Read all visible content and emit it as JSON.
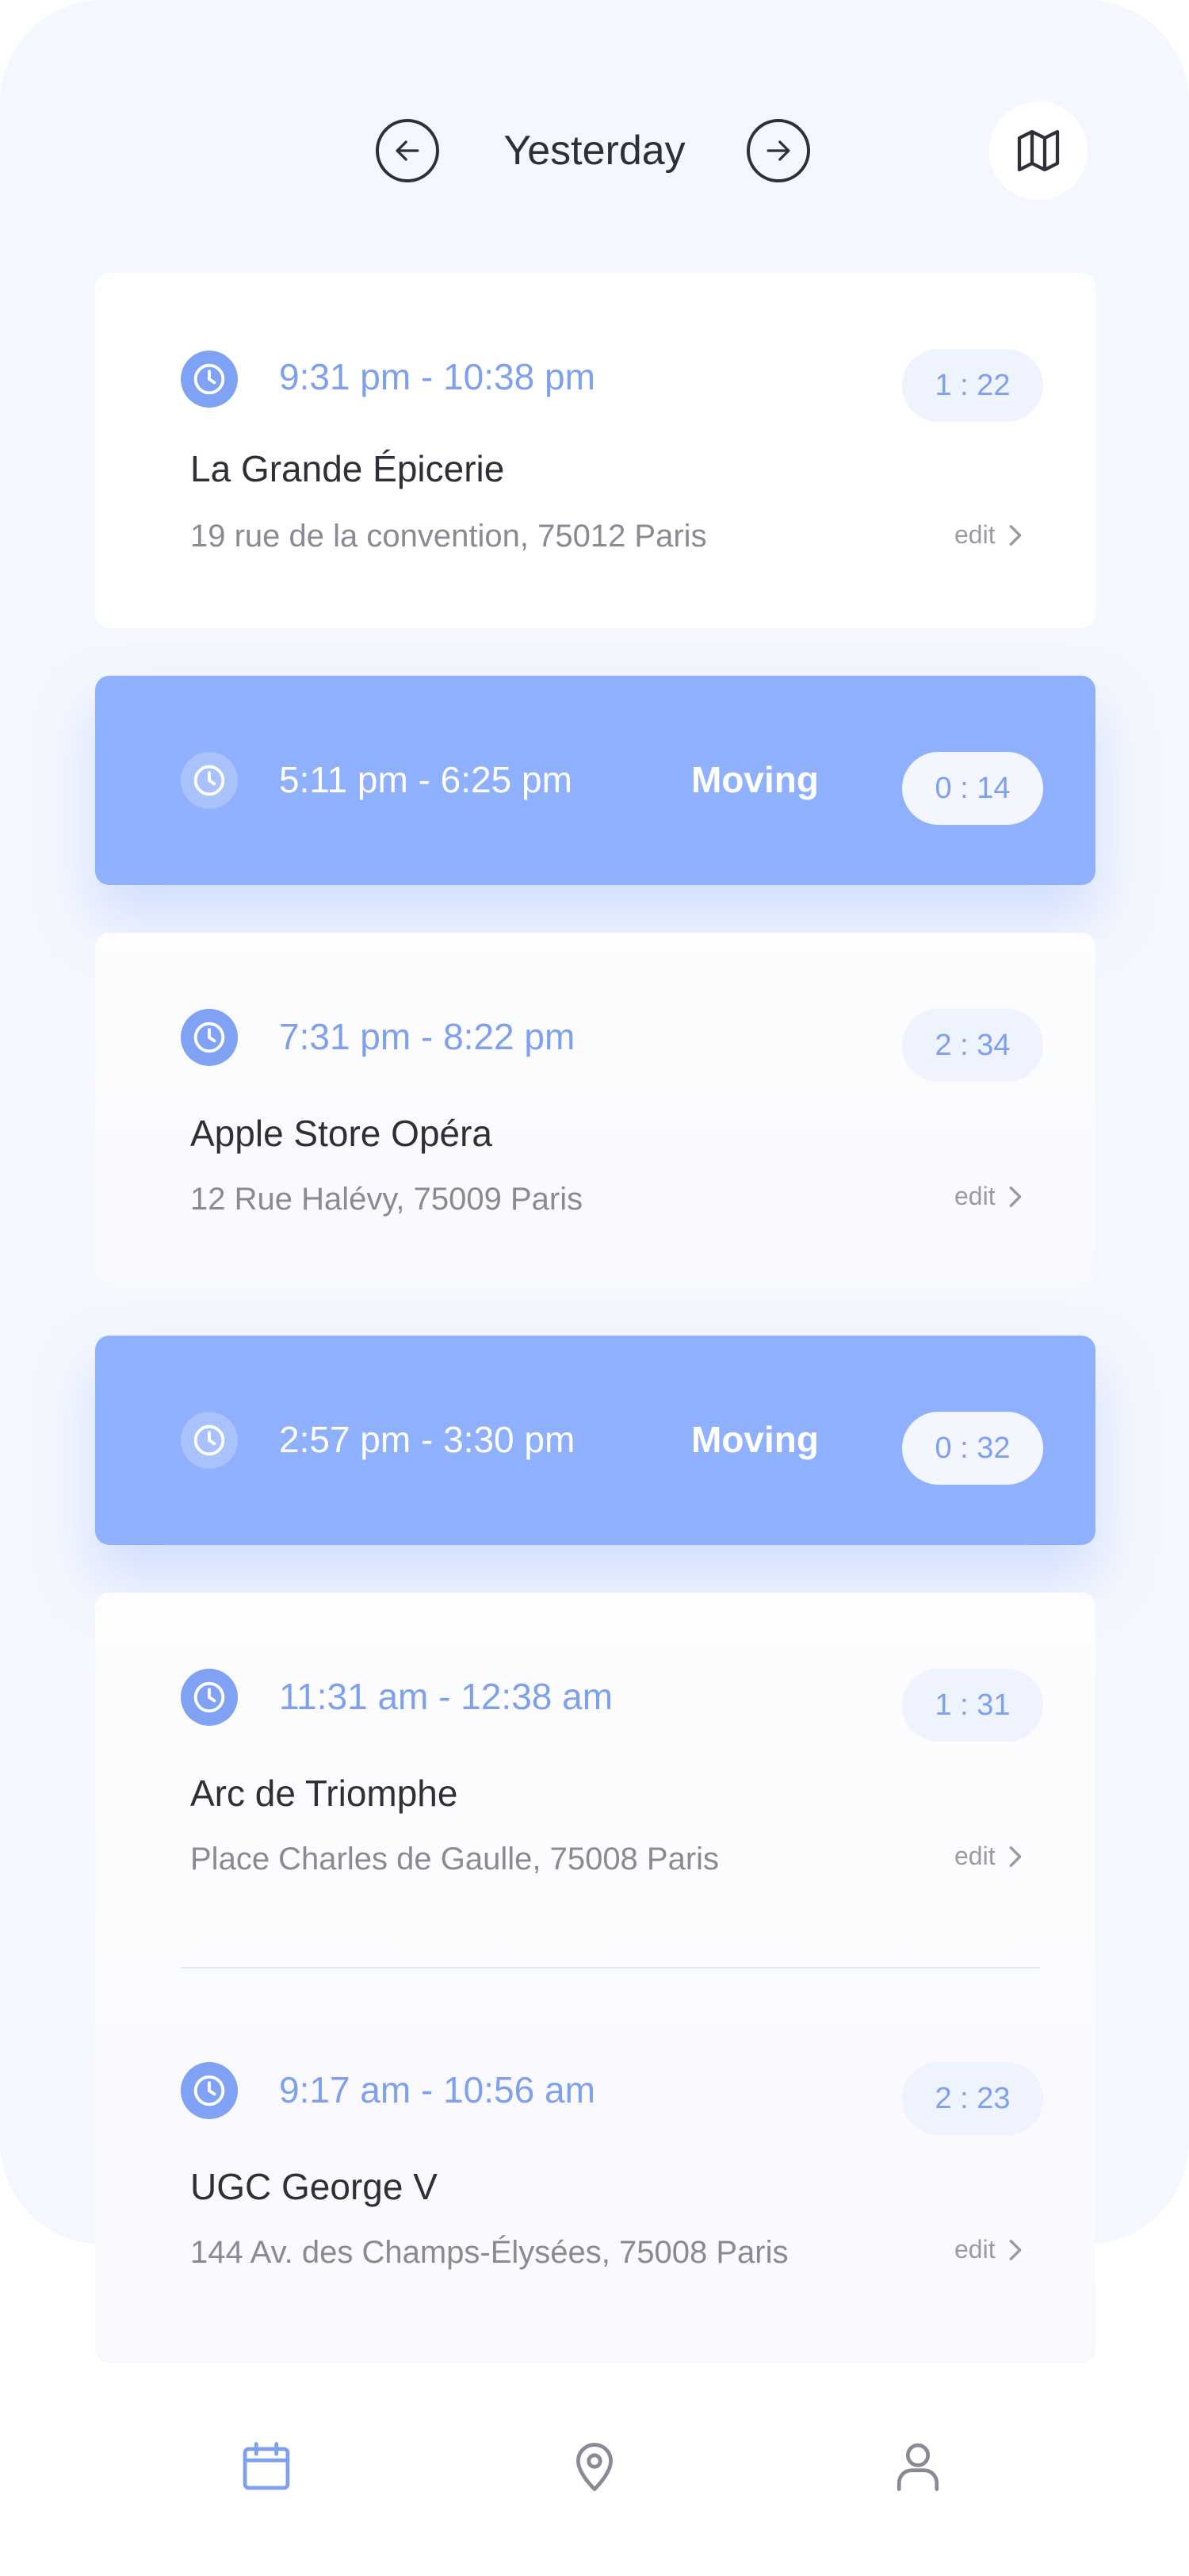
{
  "header": {
    "title": "Yesterday",
    "prev_icon": "arrow-left-circle-icon",
    "next_icon": "arrow-right-circle-icon",
    "map_icon": "map-icon"
  },
  "colors": {
    "accent": "#7ea0ee",
    "moving_card": "#8fb0fc",
    "background": "#f4f7fe",
    "text_dark": "#2f2f3a",
    "text_muted": "#8a8a94"
  },
  "entries": [
    {
      "type": "place",
      "time": "9:31 pm - 10:38 pm",
      "duration": "1 : 22",
      "name": "La Grande Épicerie",
      "address": "19 rue de la convention, 75012 Paris",
      "edit_label": "edit"
    },
    {
      "type": "moving",
      "time": "5:11 pm - 6:25 pm",
      "status": "Moving",
      "duration": "0 : 14"
    },
    {
      "type": "place",
      "time": "7:31 pm - 8:22 pm",
      "duration": "2 : 34",
      "name": "Apple Store Opéra",
      "address": "12 Rue Halévy, 75009 Paris",
      "edit_label": "edit"
    },
    {
      "type": "moving",
      "time": "2:57 pm - 3:30 pm",
      "status": "Moving",
      "duration": "0 : 32"
    },
    {
      "type": "place",
      "time": "11:31 am - 12:38 am",
      "duration": "1 : 31",
      "name": "Arc de Triomphe",
      "address": "Place Charles de Gaulle, 75008 Paris",
      "edit_label": "edit"
    },
    {
      "type": "place",
      "time": "9:17 am - 10:56 am",
      "duration": "2 : 23",
      "name": "UGC George V",
      "address": "144 Av. des Champs-Élysées, 75008 Paris",
      "edit_label": "edit"
    }
  ],
  "bottom_nav": {
    "items": [
      {
        "icon": "calendar-icon",
        "active": true
      },
      {
        "icon": "location-pin-icon",
        "active": false
      },
      {
        "icon": "user-icon",
        "active": false
      }
    ]
  }
}
